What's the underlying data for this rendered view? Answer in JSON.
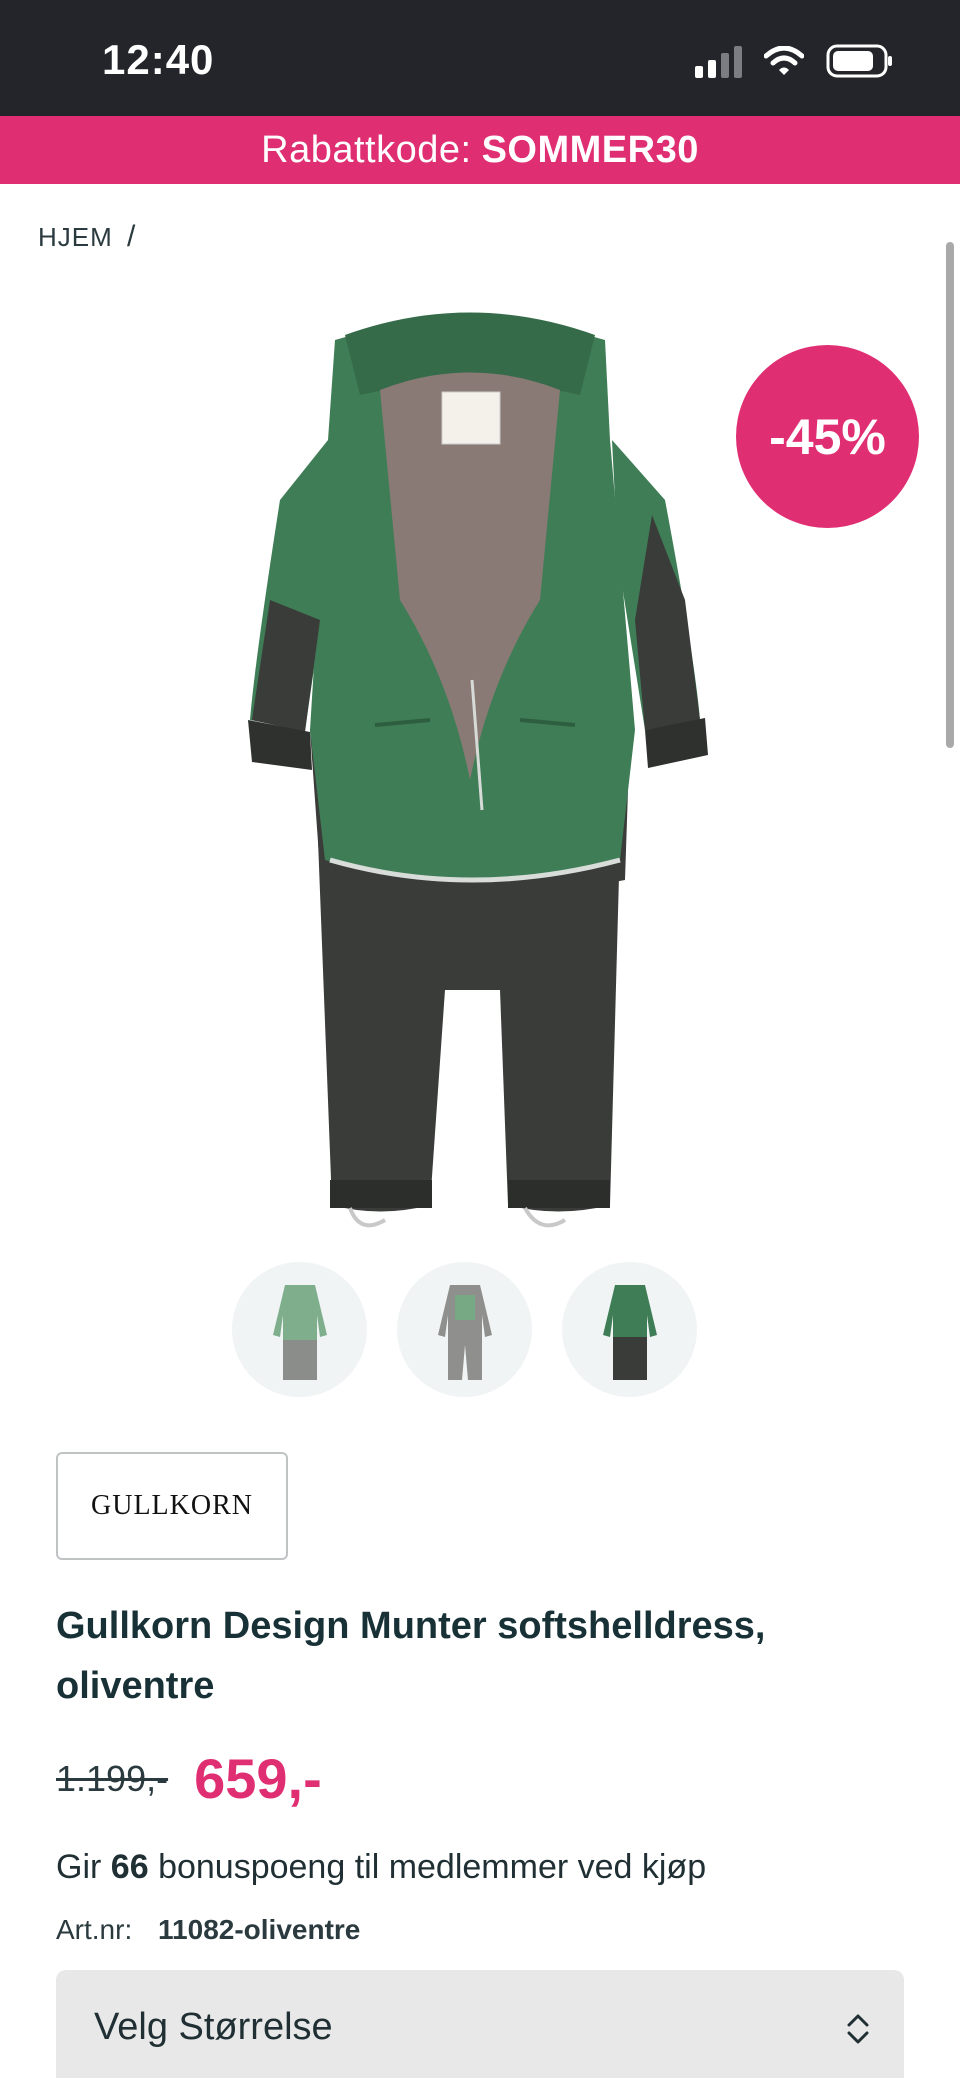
{
  "status_bar": {
    "time": "12:40"
  },
  "promo": {
    "prefix": "Rabattkode:",
    "code": "SOMMER30",
    "color": "#e02e72"
  },
  "breadcrumb": {
    "home": "HJEM",
    "separator": "/"
  },
  "product": {
    "discount_badge": "-45%",
    "brand": "GULLKORN",
    "title": "Gullkorn Design Munter softshelldress, oliventre",
    "old_price": "1.199,-",
    "price": "659,-",
    "bonus_prefix": "Gir",
    "bonus_points": "66",
    "bonus_suffix": "bonuspoeng til medlemmer ved kjøp",
    "artnr_label": "Art.nr:",
    "artnr_value": "11082-oliventre",
    "thumbnails": [
      "light-green",
      "grey",
      "olive-green"
    ]
  },
  "size_select": {
    "label": "Velg Størrelse"
  },
  "icons": [
    "signal-icon",
    "wifi-icon",
    "battery-icon",
    "chevron-updown-icon"
  ]
}
